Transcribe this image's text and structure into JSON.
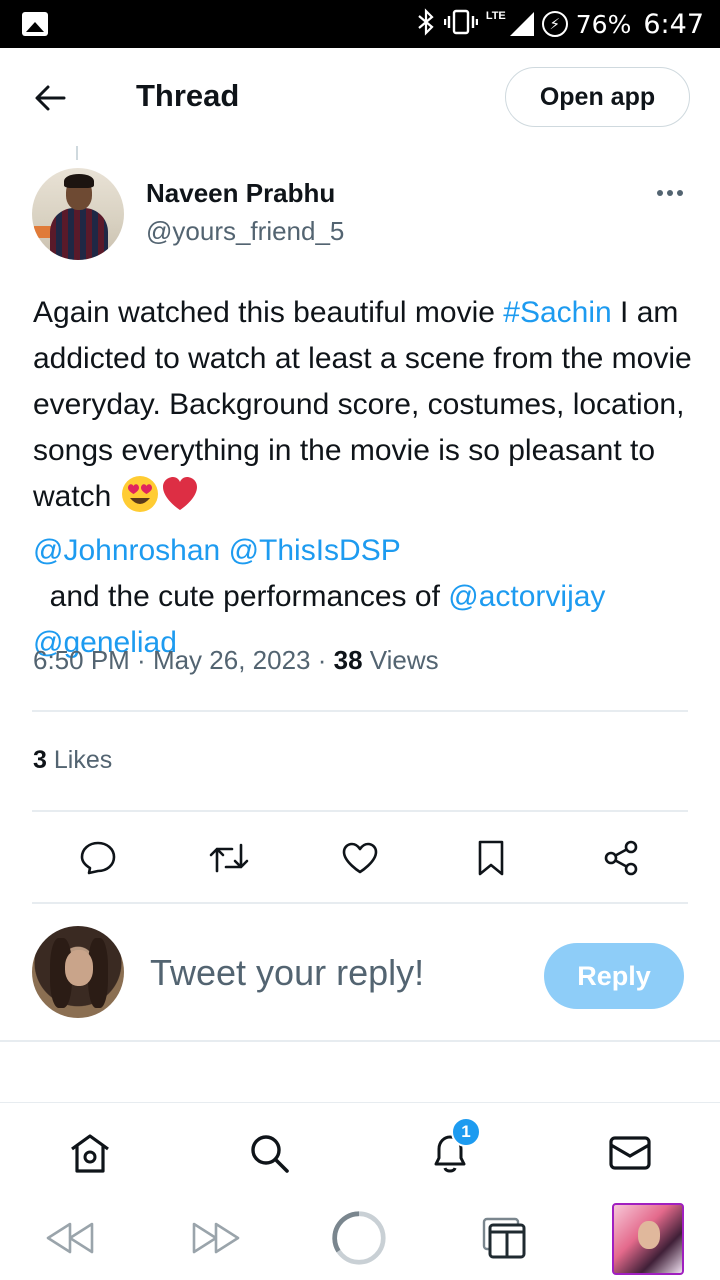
{
  "status_bar": {
    "battery_percent": "76%",
    "time": "6:47",
    "network": "LTE"
  },
  "header": {
    "title": "Thread",
    "open_app_label": "Open app"
  },
  "tweet": {
    "author_name": "Naveen Prabhu",
    "author_handle": "@yours_friend_5",
    "text_segments": {
      "s1": "Again watched this beautiful movie ",
      "hashtag": "#Sachin",
      "s2": " I am addicted to watch at least a scene from the movie everyday. Background score, costumes, location, songs everything in the movie is so pleasant to watch ",
      "mention1": "@Johnroshan",
      "mention2": "@ThisIsDSP",
      "s3": "  and the cute performances of ",
      "mention3": "@actorvijay",
      "mention4": "@geneliad"
    },
    "time": "6:50 PM",
    "date": "May 26, 2023",
    "views_count": "38",
    "views_label": "Views",
    "likes_count": "3",
    "likes_label": "Likes"
  },
  "reply": {
    "placeholder": "Tweet your reply!",
    "button_label": "Reply"
  },
  "bottom_nav": {
    "notifications_badge": "1"
  },
  "colors": {
    "accent": "#1d9bf0",
    "reply_button": "#8ecdf8",
    "secondary_text": "#536471",
    "divider": "#e7ecf0"
  },
  "icons": {
    "status_bar": [
      "gallery-icon",
      "bluetooth-icon",
      "vibrate-icon",
      "signal-icon",
      "battery-saver-icon"
    ],
    "actions": [
      "reply-icon",
      "retweet-icon",
      "like-icon",
      "bookmark-icon",
      "share-icon"
    ],
    "bottom_nav": [
      "home-icon",
      "search-icon",
      "notifications-icon",
      "messages-icon"
    ],
    "browser": [
      "back-icon",
      "forward-icon",
      "reload-icon",
      "tabs-icon"
    ]
  }
}
